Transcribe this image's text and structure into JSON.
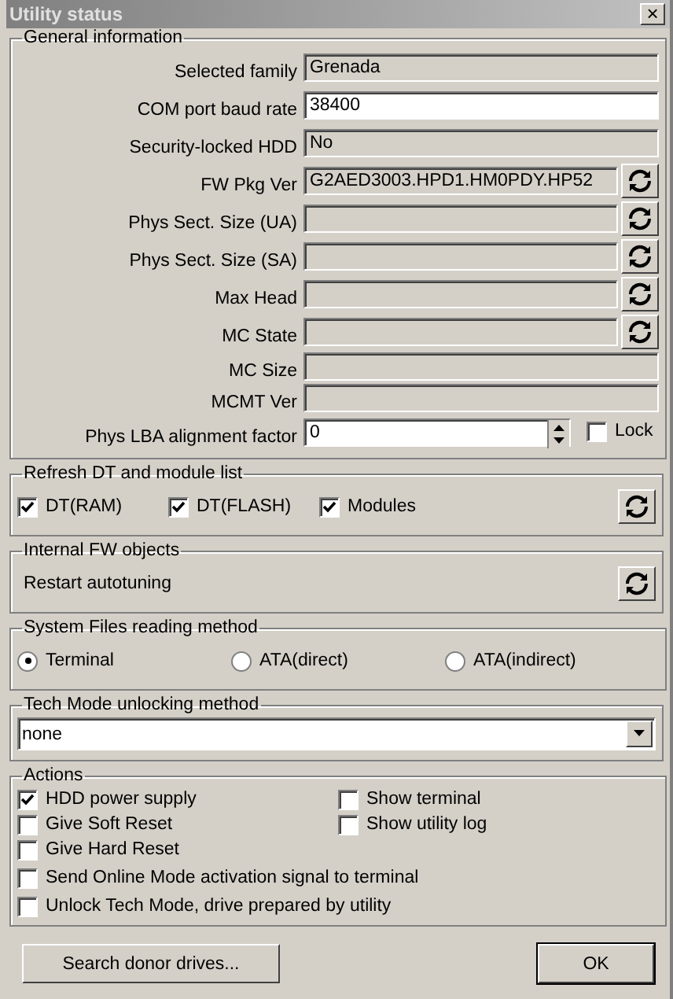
{
  "window": {
    "title": "Utility status",
    "close": "×"
  },
  "general_information": {
    "title": "General information",
    "fields": [
      {
        "label": "Selected family",
        "value": "Grenada",
        "kind": "readonly",
        "refresh": false
      },
      {
        "label": "COM port baud rate",
        "value": "38400",
        "kind": "input"
      },
      {
        "label": "Security-locked HDD",
        "value": "No",
        "kind": "readonly",
        "refresh": false
      },
      {
        "label": "FW Pkg Ver",
        "value": "G2AED3003.HPD1.HM0PDY.HP52",
        "kind": "readonly",
        "refresh": true
      },
      {
        "label": "Phys Sect. Size (UA)",
        "kind": "readonly",
        "refresh": true
      },
      {
        "label": "Phys Sect. Size (SA)",
        "kind": "readonly",
        "refresh": true
      },
      {
        "label": "Max Head",
        "kind": "readonly",
        "refresh": true
      },
      {
        "label": "MC State",
        "kind": "readonly",
        "refresh": true
      },
      {
        "label": "MC Size",
        "kind": "readonly",
        "refresh": false
      },
      {
        "label": "MCMT Ver",
        "kind": "readonly",
        "refresh": false
      },
      {
        "label": "Phys LBA alignment factor",
        "value": "0",
        "kind": "spin",
        "lock": {
          "label": "Lock",
          "checked": false
        }
      }
    ]
  },
  "refresh_dt": {
    "title": "Refresh DT and module list",
    "options": [
      {
        "label": "DT(RAM)",
        "checked": true
      },
      {
        "label": "DT(FLASH)",
        "checked": true
      },
      {
        "label": "Modules",
        "checked": true
      }
    ]
  },
  "internal_fw_objects": {
    "title": "Internal FW objects",
    "item": "Restart autotuning"
  },
  "system_files_reading_method": {
    "title": "System Files reading method",
    "options": [
      {
        "label": "Terminal",
        "selected": true
      },
      {
        "label": "ATA(direct)",
        "selected": false
      },
      {
        "label": "ATA(indirect)",
        "selected": false
      }
    ]
  },
  "tech_mode_unlocking_method": {
    "title": "Tech Mode unlocking method",
    "value": "none"
  },
  "actions": {
    "title": "Actions",
    "left": [
      {
        "label": "HDD power supply",
        "checked": true
      },
      {
        "label": "Give Soft Reset",
        "checked": false
      },
      {
        "label": "Give Hard Reset",
        "checked": false
      }
    ],
    "right": [
      {
        "label": "Show terminal",
        "checked": false
      },
      {
        "label": "Show utility log",
        "checked": false
      }
    ],
    "wide": [
      {
        "label": "Send Online Mode activation signal to terminal",
        "checked": false
      },
      {
        "label": "Unlock Tech Mode, drive prepared by utility",
        "checked": false
      }
    ]
  },
  "buttons": [
    {
      "label": "Search donor drives...",
      "kind": "normal"
    },
    {
      "label": "OK",
      "kind": "default"
    }
  ]
}
